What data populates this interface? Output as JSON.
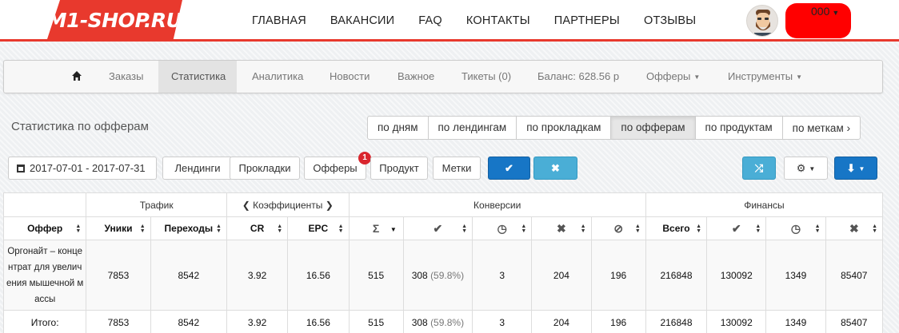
{
  "header": {
    "logo_text": "M1-SHOP.RU",
    "nav": [
      "ГЛАВНАЯ",
      "ВАКАНСИИ",
      "FAQ",
      "КОНТАКТЫ",
      "ПАРТНЕРЫ",
      "ОТЗЫВЫ"
    ],
    "user_name": "000",
    "accent_color": "#e8392d"
  },
  "menu": {
    "items": [
      "Заказы",
      "Статистика",
      "Аналитика",
      "Новости",
      "Важное",
      "Тикеты (0)",
      "Баланс: 628.56 р",
      "Офферы",
      "Инструменты"
    ],
    "active": "Статистика"
  },
  "stats": {
    "title": "Статистика по офферам",
    "tabs": [
      "по дням",
      "по лендингам",
      "по прокладкам",
      "по офферам",
      "по продуктам",
      "по меткам"
    ],
    "active_tab": "по офферам"
  },
  "filters": {
    "date_range": "2017-07-01 - 2017-07-31",
    "buttons": [
      "Лендинги",
      "Прокладки",
      "Офферы",
      "Продукт",
      "Метки"
    ],
    "offers_badge": "1",
    "apply_color": "#1776c6",
    "reset_color": "#4aaed6"
  },
  "table": {
    "groups": [
      "Трафик",
      "Коэффициенты",
      "Конверсии",
      "Финансы"
    ],
    "columns": [
      "Оффер",
      "Уники",
      "Переходы",
      "CR",
      "EPC",
      "Σ",
      "",
      "",
      "",
      "",
      "Всего",
      "",
      "",
      ""
    ],
    "column_icons": [
      "",
      "",
      "",
      "",
      "",
      "sigma-icon",
      "check-icon",
      "clock-icon",
      "cross-icon",
      "ban-icon",
      "",
      "check-icon",
      "clock-icon",
      "cross-icon"
    ],
    "rows": [
      {
        "offer": "Оргонайт – концентрат для увеличения мышечной массы",
        "uniques": "7853",
        "clicks": "8542",
        "cr": "3.92",
        "epc": "16.56",
        "total": "515",
        "approved": "308",
        "approved_pct": "(59.8%)",
        "pending": "3",
        "rejected": "204",
        "trash": "196",
        "fin_total": "216848",
        "fin_approved": "130092",
        "fin_pending": "1349",
        "fin_rejected": "85407"
      }
    ],
    "totals": {
      "label": "Итого:",
      "uniques": "7853",
      "clicks": "8542",
      "cr": "3.92",
      "epc": "16.56",
      "total": "515",
      "approved": "308",
      "approved_pct": "(59.8%)",
      "pending": "3",
      "rejected": "204",
      "trash": "196",
      "fin_total": "216848",
      "fin_approved": "130092",
      "fin_pending": "1349",
      "fin_rejected": "85407"
    }
  }
}
